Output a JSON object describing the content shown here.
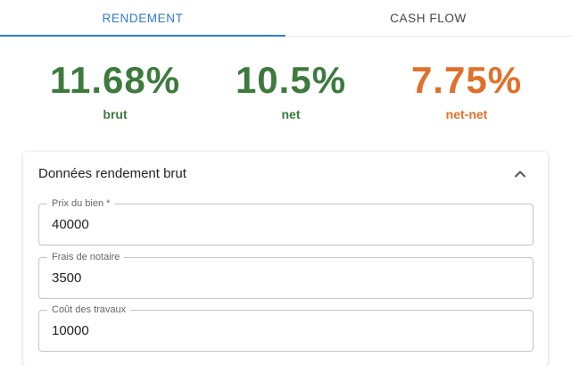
{
  "tabs": [
    {
      "label": "RENDEMENT",
      "active": true
    },
    {
      "label": "CASH FLOW",
      "active": false
    }
  ],
  "stats": [
    {
      "value": "11.68%",
      "label": "brut",
      "color": "#3d7a3d"
    },
    {
      "value": "10.5%",
      "label": "net",
      "color": "#3d7a3d"
    },
    {
      "value": "7.75%",
      "label": "net-net",
      "color": "#e0702a"
    }
  ],
  "section": {
    "title": "Données rendement brut",
    "toggle_icon": "chevron-up-icon",
    "fields": [
      {
        "label": "Prix du bien *",
        "value": "40000"
      },
      {
        "label": "Frais de notaire",
        "value": "3500"
      },
      {
        "label": "Coût des travaux",
        "value": "10000"
      }
    ]
  },
  "colors": {
    "accent": "#2f7bd1",
    "positive": "#3d7a3d",
    "warning": "#e0702a"
  }
}
